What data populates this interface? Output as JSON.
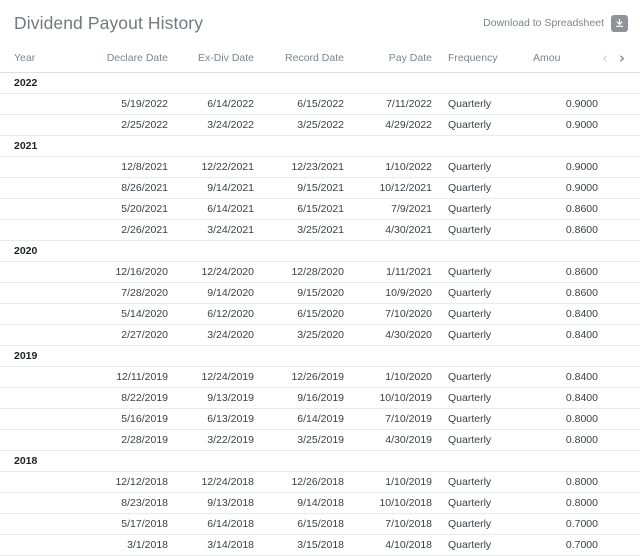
{
  "header": {
    "title": "Dividend Payout History",
    "download_label": "Download to Spreadsheet",
    "download_icon": "download-icon"
  },
  "table": {
    "columns": [
      {
        "key": "year",
        "label": "Year"
      },
      {
        "key": "declare",
        "label": "Declare Date"
      },
      {
        "key": "exdiv",
        "label": "Ex-Div Date"
      },
      {
        "key": "record",
        "label": "Record Date"
      },
      {
        "key": "pay",
        "label": "Pay Date"
      },
      {
        "key": "freq",
        "label": "Frequency"
      },
      {
        "key": "amount",
        "label": "Amou"
      }
    ],
    "amount_full_label": "Amount",
    "pagination": {
      "prev_icon": "chevron-left-icon",
      "next_icon": "chevron-right-icon",
      "prev_enabled": false,
      "next_enabled": true
    },
    "groups": [
      {
        "year": "2022",
        "rows": [
          {
            "declare": "5/19/2022",
            "exdiv": "6/14/2022",
            "record": "6/15/2022",
            "pay": "7/11/2022",
            "freq": "Quarterly",
            "amount": "0.9000"
          },
          {
            "declare": "2/25/2022",
            "exdiv": "3/24/2022",
            "record": "3/25/2022",
            "pay": "4/29/2022",
            "freq": "Quarterly",
            "amount": "0.9000"
          }
        ]
      },
      {
        "year": "2021",
        "rows": [
          {
            "declare": "12/8/2021",
            "exdiv": "12/22/2021",
            "record": "12/23/2021",
            "pay": "1/10/2022",
            "freq": "Quarterly",
            "amount": "0.9000"
          },
          {
            "declare": "8/26/2021",
            "exdiv": "9/14/2021",
            "record": "9/15/2021",
            "pay": "10/12/2021",
            "freq": "Quarterly",
            "amount": "0.9000"
          },
          {
            "declare": "5/20/2021",
            "exdiv": "6/14/2021",
            "record": "6/15/2021",
            "pay": "7/9/2021",
            "freq": "Quarterly",
            "amount": "0.8600"
          },
          {
            "declare": "2/26/2021",
            "exdiv": "3/24/2021",
            "record": "3/25/2021",
            "pay": "4/30/2021",
            "freq": "Quarterly",
            "amount": "0.8600"
          }
        ]
      },
      {
        "year": "2020",
        "rows": [
          {
            "declare": "12/16/2020",
            "exdiv": "12/24/2020",
            "record": "12/28/2020",
            "pay": "1/11/2021",
            "freq": "Quarterly",
            "amount": "0.8600"
          },
          {
            "declare": "7/28/2020",
            "exdiv": "9/14/2020",
            "record": "9/15/2020",
            "pay": "10/9/2020",
            "freq": "Quarterly",
            "amount": "0.8600"
          },
          {
            "declare": "5/14/2020",
            "exdiv": "6/12/2020",
            "record": "6/15/2020",
            "pay": "7/10/2020",
            "freq": "Quarterly",
            "amount": "0.8400"
          },
          {
            "declare": "2/27/2020",
            "exdiv": "3/24/2020",
            "record": "3/25/2020",
            "pay": "4/30/2020",
            "freq": "Quarterly",
            "amount": "0.8400"
          }
        ]
      },
      {
        "year": "2019",
        "rows": [
          {
            "declare": "12/11/2019",
            "exdiv": "12/24/2019",
            "record": "12/26/2019",
            "pay": "1/10/2020",
            "freq": "Quarterly",
            "amount": "0.8400"
          },
          {
            "declare": "8/22/2019",
            "exdiv": "9/13/2019",
            "record": "9/16/2019",
            "pay": "10/10/2019",
            "freq": "Quarterly",
            "amount": "0.8400"
          },
          {
            "declare": "5/16/2019",
            "exdiv": "6/13/2019",
            "record": "6/14/2019",
            "pay": "7/10/2019",
            "freq": "Quarterly",
            "amount": "0.8000"
          },
          {
            "declare": "2/28/2019",
            "exdiv": "3/22/2019",
            "record": "3/25/2019",
            "pay": "4/30/2019",
            "freq": "Quarterly",
            "amount": "0.8000"
          }
        ]
      },
      {
        "year": "2018",
        "rows": [
          {
            "declare": "12/12/2018",
            "exdiv": "12/24/2018",
            "record": "12/26/2018",
            "pay": "1/10/2019",
            "freq": "Quarterly",
            "amount": "0.8000"
          },
          {
            "declare": "8/23/2018",
            "exdiv": "9/13/2018",
            "record": "9/14/2018",
            "pay": "10/10/2018",
            "freq": "Quarterly",
            "amount": "0.8000"
          },
          {
            "declare": "5/17/2018",
            "exdiv": "6/14/2018",
            "record": "6/15/2018",
            "pay": "7/10/2018",
            "freq": "Quarterly",
            "amount": "0.7000"
          },
          {
            "declare": "3/1/2018",
            "exdiv": "3/14/2018",
            "record": "3/15/2018",
            "pay": "4/10/2018",
            "freq": "Quarterly",
            "amount": "0.7000"
          }
        ]
      }
    ]
  },
  "colors": {
    "title": "#73797f",
    "muted": "#7d848a",
    "text": "#3c4043",
    "rule": "#e8eaeb",
    "header_rule": "#dfe1e3",
    "icon_bg": "#8d9398",
    "chevron_disabled": "#ccd0d3",
    "chevron_enabled": "#6e757b"
  }
}
